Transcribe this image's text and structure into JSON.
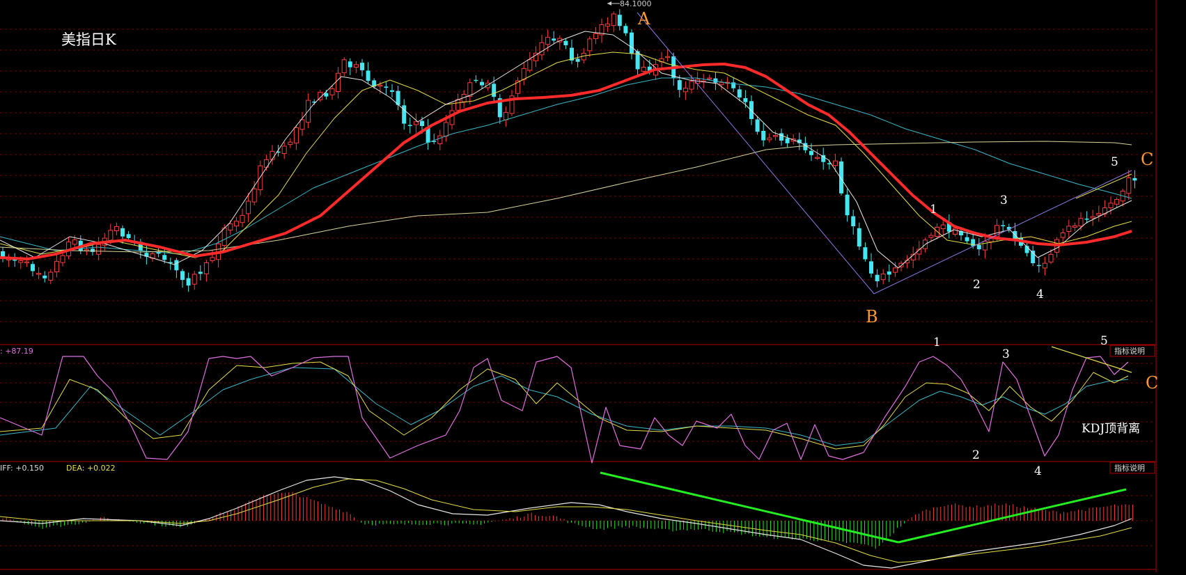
{
  "price_panel": {
    "title": "美指日K",
    "peak_label": "84.1000",
    "wave_labels": [
      "A",
      "B",
      "C",
      "1",
      "2",
      "3",
      "4",
      "5"
    ]
  },
  "kdj_panel": {
    "readout": ": +87.19",
    "button": "指标说明",
    "annotation": "KDJ顶背离",
    "wave_labels": [
      "1",
      "2",
      "3",
      "4",
      "5",
      "C"
    ]
  },
  "macd_panel": {
    "readout_diff": "IFF: +0.150",
    "readout_dea": "DEA: +0.022",
    "button": "指标说明"
  },
  "colors": {
    "up": "#ff3b3b",
    "down": "#45e6f0",
    "ma_thick": "#ff2a2a",
    "ma_white": "#e8e8e8",
    "ma_yellow": "#e6e04a",
    "ma_cyan": "#3ab8c8",
    "ma_khaki": "#d8d49a",
    "k_line": "#e8e8e8",
    "d_line": "#e6e04a",
    "j_line": "#e070e0",
    "wave_orange": "#ff9933",
    "trend_green": "#22ee22",
    "grid_red": "#7a0000"
  },
  "chart_data": {
    "type": "candlestick",
    "title": "美指日K",
    "annotations": [
      "84.1000",
      "A",
      "B",
      "C",
      "1",
      "2",
      "3",
      "4",
      "5",
      "KDJ顶背离"
    ],
    "high_marker": 84.1,
    "panels": [
      "price",
      "kdj",
      "macd"
    ]
  }
}
